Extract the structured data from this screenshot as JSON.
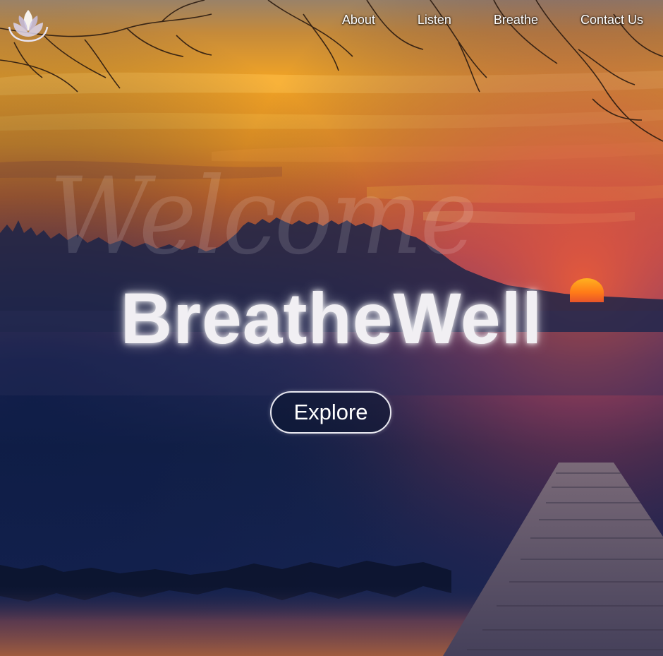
{
  "nav": {
    "logo_icon": "lotus-icon",
    "links": [
      {
        "label": "About"
      },
      {
        "label": "Listen"
      },
      {
        "label": "Breathe"
      },
      {
        "label": "Contact Us"
      }
    ]
  },
  "hero": {
    "welcome_text": "Welcome",
    "title": "BreatheWell",
    "cta_label": "Explore",
    "background_icon": "sunset-lake-dock-image"
  },
  "colors": {
    "sky_top": "#c8872a",
    "sky_orange": "#e8891c",
    "lake_dark": "#0f1d40",
    "title_text": "#f1eff3",
    "sun": "#ff8a1c"
  }
}
